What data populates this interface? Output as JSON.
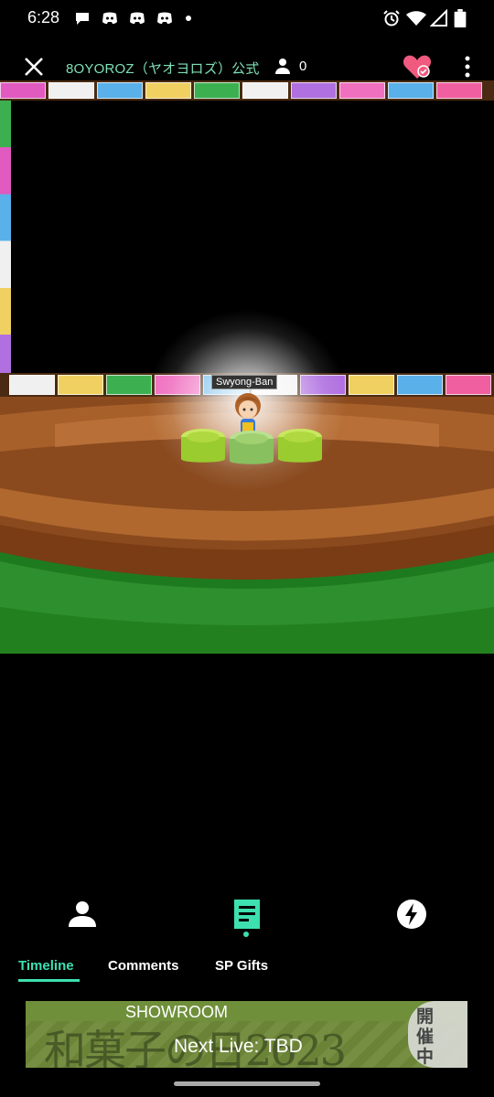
{
  "status_bar": {
    "time": "6:28",
    "left_icons": [
      "chat-bubble-icon",
      "discord-icon",
      "discord-icon",
      "discord-icon",
      "dot-icon"
    ],
    "right_icons": [
      "alarm-icon",
      "wifi-icon",
      "signal-icon",
      "battery-icon"
    ]
  },
  "header": {
    "title": "8OYOROZ（ヤオヨロズ）公式",
    "viewer_count": "0",
    "accent": "#7fe0b5",
    "heart_color": "#f05a7e"
  },
  "stage": {
    "performer_name": "Swyong-Ban"
  },
  "nav": {
    "icons": [
      "person-icon",
      "timeline-icon",
      "lightning-icon"
    ],
    "tabs": [
      "Timeline",
      "Comments",
      "SP Gifts"
    ],
    "active_tab": "Timeline",
    "accent": "#3ee0b0"
  },
  "banner": {
    "brand": "SHOWROOM",
    "next_live": "Next Live: TBD",
    "bg_text": "和菓子の日2623",
    "side_text": "開催中"
  }
}
